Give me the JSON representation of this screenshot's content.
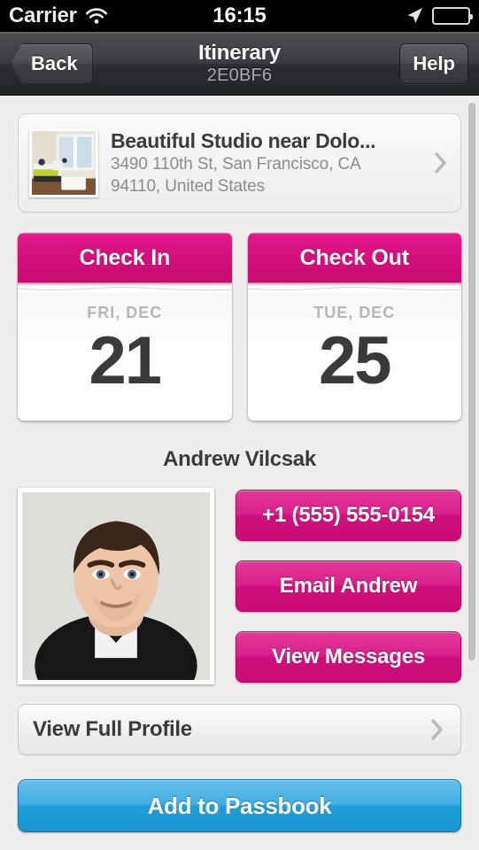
{
  "status_bar": {
    "carrier": "Carrier",
    "time": "16:15",
    "wifi_icon": "wifi-icon",
    "location_icon": "location-arrow-icon",
    "battery_icon": "battery-icon"
  },
  "nav_bar": {
    "back_label": "Back",
    "title": "Itinerary",
    "subtitle": "2E0BF6",
    "help_label": "Help"
  },
  "listing": {
    "title": "Beautiful Studio near Dolo...",
    "address_line1": "3490 110th St, San Francisco, CA",
    "address_line2": "94110, United States",
    "thumbnail_alt": "studio-interior-photo",
    "disclosure_icon": "chevron-right-icon"
  },
  "dates": [
    {
      "header": "Check In",
      "weekday_month": "FRI, DEC",
      "day": "21"
    },
    {
      "header": "Check Out",
      "weekday_month": "TUE, DEC",
      "day": "25"
    }
  ],
  "host": {
    "name": "Andrew Vilcsak",
    "photo_alt": "host-portrait-photo",
    "actions": [
      {
        "label": "+1 (555) 555-0154",
        "name": "call-host-button"
      },
      {
        "label": "Email Andrew",
        "name": "email-host-button"
      },
      {
        "label": "View Messages",
        "name": "view-messages-button"
      }
    ],
    "profile_label": "View Full Profile",
    "profile_disclosure_icon": "chevron-right-icon"
  },
  "passbook": {
    "label": "Add to Passbook"
  },
  "colors": {
    "accent_pink": "#D40F7C",
    "accent_blue": "#1FA0DA",
    "nav_dark": "#3A3C3F",
    "page_background": "#EFEEEC",
    "text_primary": "#3B3B3B",
    "text_secondary": "#8C8C8C"
  }
}
